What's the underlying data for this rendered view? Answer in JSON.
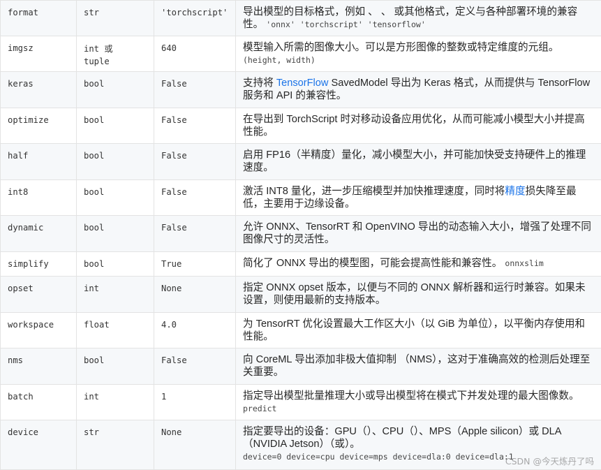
{
  "rows": [
    {
      "arg": "format",
      "type": "str",
      "default": "'torchscript'",
      "desc": "导出模型的目标格式，例如 、 、 或其他格式，定义与各种部署环境的兼容性。",
      "codes": "'onnx' 'torchscript' 'tensorflow'"
    },
    {
      "arg": "imgsz",
      "type": "int 或 tuple",
      "default": "640",
      "desc": "模型输入所需的图像大小。可以是方形图像的整数或特定维度的元组。",
      "codes": "(height, width)"
    },
    {
      "arg": "keras",
      "type": "bool",
      "default": "False",
      "desc_pre": "支持将 ",
      "desc_link": "TensorFlow",
      "desc_post": " SavedModel 导出为 Keras 格式，从而提供与 TensorFlow 服务和 API 的兼容性。"
    },
    {
      "arg": "optimize",
      "type": "bool",
      "default": "False",
      "desc": "在导出到 TorchScript 时对移动设备应用优化，从而可能减小模型大小并提高性能。"
    },
    {
      "arg": "half",
      "type": "bool",
      "default": "False",
      "desc": "启用 FP16（半精度）量化，减小模型大小，并可能加快受支持硬件上的推理速度。"
    },
    {
      "arg": "int8",
      "type": "bool",
      "default": "False",
      "desc_pre": "激活 INT8 量化，进一步压缩模型并加快推理速度，同时将",
      "desc_link": "精度",
      "desc_post": "损失降至最低，主要用于边缘设备。"
    },
    {
      "arg": "dynamic",
      "type": "bool",
      "default": "False",
      "desc": "允许 ONNX、TensorRT 和 OpenVINO 导出的动态输入大小，增强了处理不同图像尺寸的灵活性。"
    },
    {
      "arg": "simplify",
      "type": "bool",
      "default": "True",
      "desc": "简化了 ONNX 导出的模型图，可能会提高性能和兼容性。",
      "codes": "onnxslim"
    },
    {
      "arg": "opset",
      "type": "int",
      "default": "None",
      "desc": "指定 ONNX opset 版本，以便与不同的 ONNX 解析器和运行时兼容。如果未设置，则使用最新的支持版本。"
    },
    {
      "arg": "workspace",
      "type": "float",
      "default": "4.0",
      "desc": "为 TensorRT 优化设置最大工作区大小（以 GiB 为单位），以平衡内存使用和性能。"
    },
    {
      "arg": "nms",
      "type": "bool",
      "default": "False",
      "desc": "向 CoreML 导出添加非极大值抑制 （NMS），这对于准确高效的检测后处理至关重要。"
    },
    {
      "arg": "batch",
      "type": "int",
      "default": "1",
      "desc": "指定导出模型批量推理大小或导出模型将在模式下并发处理的最大图像数。",
      "codes": "predict"
    },
    {
      "arg": "device",
      "type": "str",
      "default": "None",
      "desc": "指定要导出的设备：GPU（）、CPU（）、MPS（Apple silicon）或 DLA（NVIDIA Jetson）（或）。",
      "codes": "device=0 device=cpu device=mps device=dla:0 device=dla:1"
    }
  ],
  "watermark": "CSDN @今天炼丹了吗"
}
